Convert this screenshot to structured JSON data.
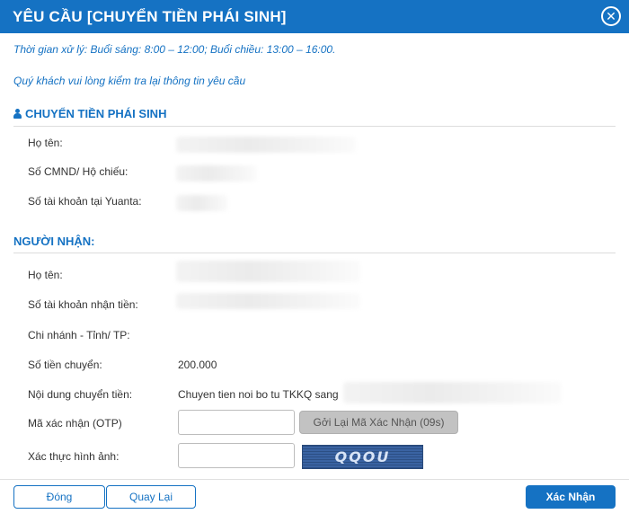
{
  "dialog": {
    "title": "YÊU CẦU [CHUYỂN TIỀN PHÁI SINH]",
    "close_icon": "close-circle-icon"
  },
  "notes": {
    "processing_time": "Thời gian xử lý: Buổi sáng: 8:00 – 12:00; Buổi chiều: 13:00 – 16:00.",
    "check_info": "Quý khách vui lòng kiểm tra lại thông tin yêu cầu"
  },
  "sender": {
    "heading": "CHUYỂN TIỀN PHÁI SINH",
    "heading_icon": "user-icon",
    "name_label": "Họ tên:",
    "id_label": "Số CMND/ Hộ chiếu:",
    "account_label": "Số tài khoản tại Yuanta:"
  },
  "receiver": {
    "heading": "NGƯỜI NHẬN:",
    "name_label": "Họ tên:",
    "account_label": "Số tài khoản nhận tiền:",
    "branch_label": "Chi nhánh - Tỉnh/ TP:",
    "amount_label": "Số tiền chuyển:",
    "amount_value": "200.000",
    "content_label": "Nội dung chuyển tiền:",
    "content_value": "Chuyen tien noi bo tu TKKQ sang"
  },
  "verification": {
    "otp_label": "Mã xác nhận (OTP)",
    "otp_value": "",
    "resend_label": "Gởi Lại Mã Xác Nhận (09s)",
    "captcha_label": "Xác thực hình ảnh:",
    "captcha_value": "",
    "captcha_text": "QQOU"
  },
  "buttons": {
    "close_label": "Đóng",
    "back_label": "Quay Lại",
    "confirm_label": "Xác Nhận"
  },
  "colors": {
    "accent": "#1572c3",
    "disabled_button": "#c2c2c2"
  }
}
